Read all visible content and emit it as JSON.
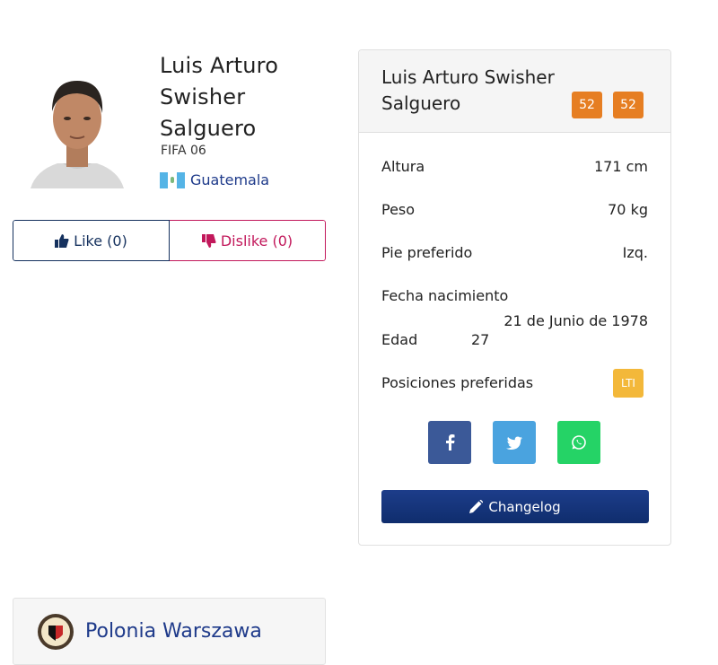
{
  "player": {
    "name": "Luis Arturo Swisher Salguero",
    "game": "FIFA 06",
    "nation": "Guatemala"
  },
  "vote": {
    "like_label": "Like (0)",
    "dislike_label": "Dislike (0)"
  },
  "club": {
    "name": "Polonia Warszawa"
  },
  "card": {
    "title": "Luis Arturo Swisher Salguero",
    "ratings": [
      "52",
      "52"
    ],
    "rows": {
      "height_label": "Altura",
      "height_value": "171 cm",
      "weight_label": "Peso",
      "weight_value": "70 kg",
      "foot_label": "Pie preferido",
      "foot_value": "Izq.",
      "birth_label": "Fecha nacimiento",
      "birth_value": "21 de Junio de 1978",
      "age_label": "Edad",
      "age_value": "27",
      "positions_label": "Posiciones preferidas",
      "position": "LTI"
    },
    "social": [
      "facebook-icon",
      "twitter-icon",
      "whatsapp-icon"
    ],
    "changelog_label": "Changelog"
  },
  "colors": {
    "rating": "#e67e22",
    "position": "#f3b83a",
    "brand": "#1e3a8a",
    "dislike": "#c2185b"
  }
}
